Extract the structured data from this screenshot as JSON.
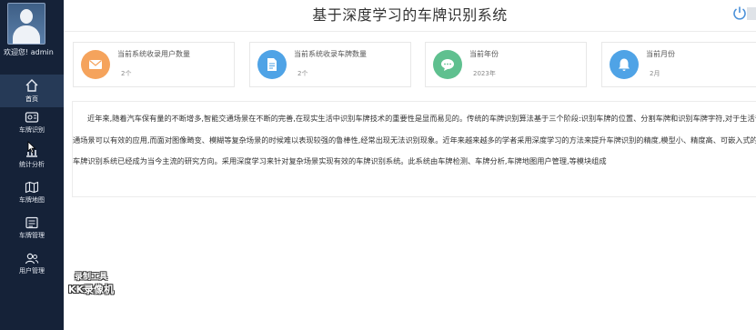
{
  "header": {
    "title": "基于深度学习的车牌识别系统"
  },
  "user": {
    "welcome": "欢迎您! admin"
  },
  "sidebar": {
    "items": [
      {
        "label": "首页",
        "icon": "home-icon",
        "active": true
      },
      {
        "label": "车牌识别",
        "icon": "plate-recognize-icon",
        "active": false
      },
      {
        "label": "统计分析",
        "icon": "statistics-icon",
        "active": false
      },
      {
        "label": "车牌地图",
        "icon": "map-icon",
        "active": false
      },
      {
        "label": "车牌管理",
        "icon": "plate-manage-icon",
        "active": false
      },
      {
        "label": "用户管理",
        "icon": "user-manage-icon",
        "active": false
      }
    ]
  },
  "stats": [
    {
      "title": "当前系统收录用户数量",
      "value": "2个",
      "icon": "mail-icon",
      "color": "#f5a35c"
    },
    {
      "title": "当前系统收录车牌数量",
      "value": "2个",
      "icon": "document-icon",
      "color": "#4fa3e6"
    },
    {
      "title": "当前年份",
      "value": "2023年",
      "icon": "chat-icon",
      "color": "#5fc08f"
    },
    {
      "title": "当前月份",
      "value": "2月",
      "icon": "bell-icon",
      "color": "#4fa3e6"
    }
  ],
  "intro": {
    "text": "近年来,随着汽车保有量的不断增多,智能交通场景在不断的完善,在现实生活中识别车牌技术的重要性是显而易见的。传统的车牌识别算法基于三个阶段:识别车牌的位置、分割车牌和识别车牌字符,对于生活普通场景可以有效的应用,而面对图像畸变、模糊等复杂场景的时候难以表现较强的鲁棒性,经常出现无法识别现象。近年来越来越多的学者采用深度学习的方法来提升车牌识别的精度,模型小、精度高、可嵌入式的车牌识别系统已经成为当今主流的研究方向。采用深度学习来针对复杂场景实现有效的车牌识别系统。此系统由车牌检测、车牌分析,车牌地图用户管理,等模块组成"
  },
  "watermark": {
    "line1": "录制工具",
    "line2": "KK录像机"
  }
}
